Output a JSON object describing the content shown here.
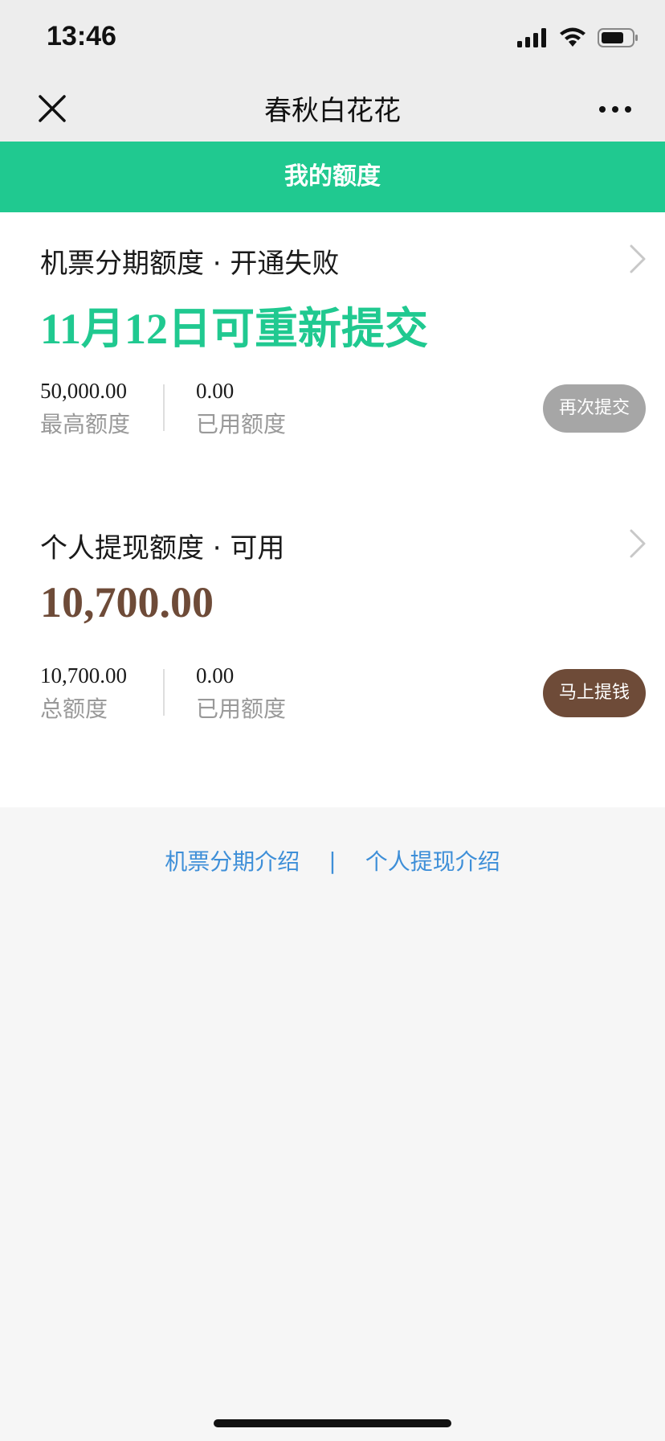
{
  "status_bar": {
    "time": "13:46",
    "icons": [
      "cellular-signal-icon",
      "wifi-icon",
      "battery-icon"
    ]
  },
  "nav": {
    "title": "春秋白花花",
    "close_icon": "close-icon",
    "more_icon": "more-icon"
  },
  "header": {
    "title": "我的额度",
    "color": "#20c990"
  },
  "sections": [
    {
      "title": "机票分期额度 · 开通失败",
      "big_text": "11月12日可重新提交",
      "big_color": "#20c990",
      "stats": [
        {
          "value": "50,000.00",
          "label": "最高额度"
        },
        {
          "value": "0.00",
          "label": "已用额度"
        }
      ],
      "button_label": "再次提交",
      "button_color": "#a6a6a6"
    },
    {
      "title": "个人提现额度 · 可用",
      "big_text": "10,700.00",
      "big_color": "#6e4b38",
      "stats": [
        {
          "value": "10,700.00",
          "label": "总额度"
        },
        {
          "value": "0.00",
          "label": "已用额度"
        }
      ],
      "button_label": "马上提钱",
      "button_color": "#6e4b38"
    }
  ],
  "footer_links": {
    "left": "机票分期介绍",
    "separator": "|",
    "right": "个人提现介绍",
    "color": "#3e8fd8"
  }
}
